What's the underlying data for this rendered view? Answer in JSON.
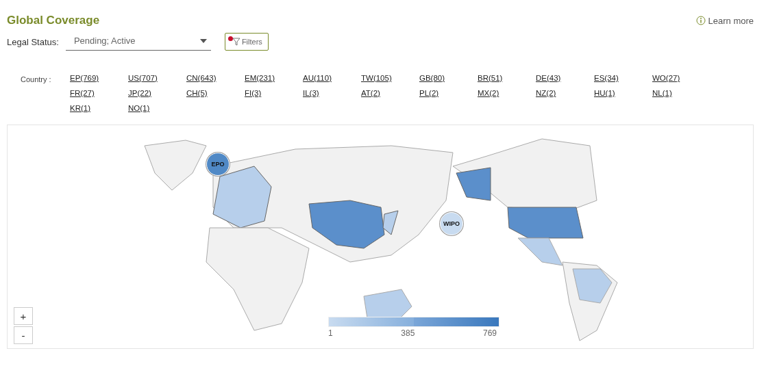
{
  "title": "Global Coverage",
  "learn_more": "Learn more",
  "legal_status": {
    "label": "Legal Status:",
    "value": "Pending; Active"
  },
  "filters_button": {
    "label": "Filters",
    "active": true
  },
  "country_filter": {
    "label": "Country :",
    "items": [
      "EP(769)",
      "US(707)",
      "CN(643)",
      "EM(231)",
      "AU(110)",
      "TW(105)",
      "GB(80)",
      "BR(51)",
      "DE(43)",
      "ES(34)",
      "WO(27)",
      "FR(27)",
      "JP(22)",
      "CH(5)",
      "FI(3)",
      "IL(3)",
      "AT(2)",
      "PL(2)",
      "MX(2)",
      "NZ(2)",
      "HU(1)",
      "NL(1)",
      "KR(1)",
      "NO(1)"
    ]
  },
  "map": {
    "markers": [
      {
        "label": "EPO",
        "color": "#5089c6"
      },
      {
        "label": "WIPO",
        "color": "#c8dbf0"
      }
    ],
    "zoom_controls": [
      "+",
      "-"
    ],
    "legend": {
      "min": "1",
      "mid": "385",
      "max": "769"
    }
  }
}
